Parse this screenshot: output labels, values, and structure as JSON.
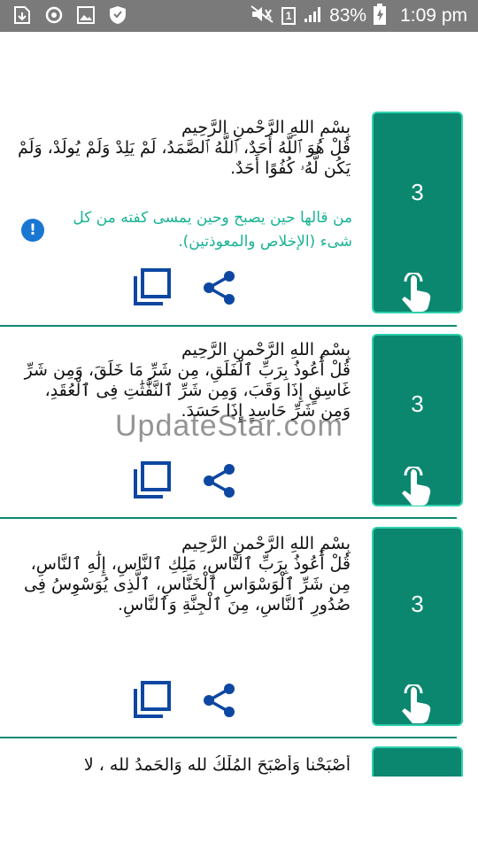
{
  "status_bar": {
    "battery_percent": "83%",
    "time": "1:09 pm",
    "sim_label": "1",
    "icons": [
      "download-notification-icon",
      "sync-icon",
      "gallery-icon",
      "shield-icon",
      "mute-icon",
      "signal-icon",
      "battery-charging-icon"
    ]
  },
  "cards": [
    {
      "basmala": "بِسْمِ اللهِ الرَّحْمنِ الرَّحِيم",
      "text": "قُلْ هُوَ ٱللَّهُ أَحَدٌ، ٱللَّهُ ٱلصَّمَدُ، لَمْ يَلِدْ وَلَمْ يُولَدْ، وَلَمْ يَكُن لَّهُۥ كُفُوًا أَحَدٌ.",
      "note": "من قالها حين يصبح وحين يمسى كفته من كل شىء (الإخلاص والمعوذتين).",
      "count": "3"
    },
    {
      "basmala": "بِسْمِ اللهِ الرَّحْمنِ الرَّحِيم",
      "text": "قُلْ أَعُوذُ بِرَبِّ ٱلْفَلَقِ، مِن شَرِّ مَا خَلَقَ، وَمِن شَرِّ غَاسِقٍ إِذَا وَقَبَ، وَمِن شَرِّ ٱلنَّفَّٰثَٰتِ فِى ٱلْعُقَدِ، وَمِن شَرِّ حَاسِدٍ إِذَا حَسَدَ.",
      "count": "3"
    },
    {
      "basmala": "بِسْمِ اللهِ الرَّحْمنِ الرَّحِيم",
      "text": "قُلْ أَعُوذُ بِرَبِّ ٱلنَّاسِ، مَلِكِ ٱلنَّاسِ، إِلَٰهِ ٱلنَّاسِ، مِن شَرِّ ٱلْوَسْوَاسِ ٱلْخَنَّاسِ، ٱلَّذِى يُوَسْوِسُ فِى صُدُورِ ٱلنَّاسِ، مِنَ ٱلْجِنَّةِ وَٱلنَّاسِ.",
      "count": "3"
    },
    {
      "text": "أَصْبَحْنا وَأَصْبَحَ المُلْكُ لله وَالحَمدُ لله ، لا"
    }
  ],
  "watermark": "UpdateStar.com",
  "colors": {
    "status_bar": "#7a7a7a",
    "counter_bg": "#0b8770",
    "counter_border": "#2ed1ad",
    "note_text": "#1ab394",
    "icon_blue": "#0d47a1",
    "info_blue": "#1976d2"
  }
}
